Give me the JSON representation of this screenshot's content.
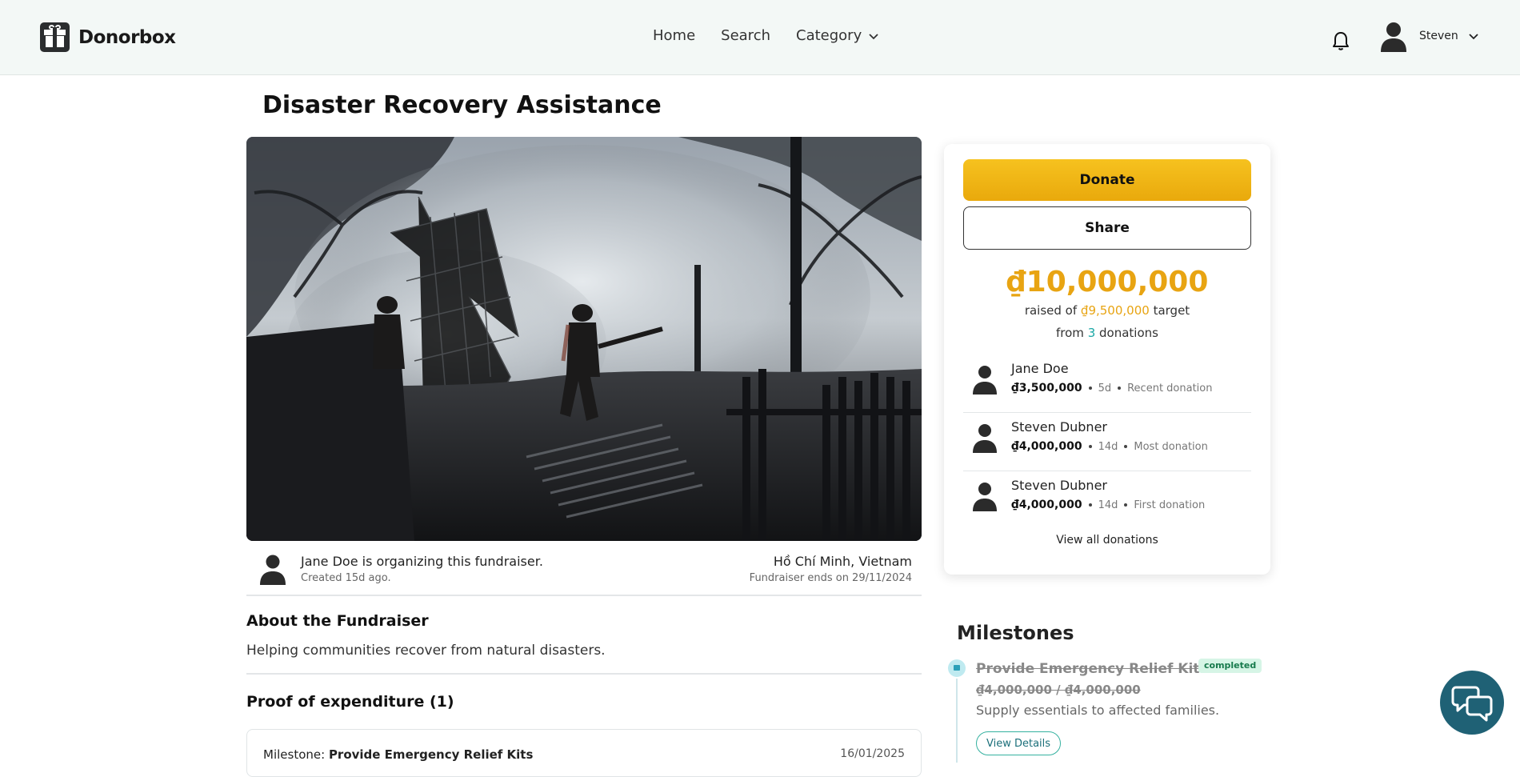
{
  "header": {
    "logo_text": "Donorbox",
    "nav": [
      {
        "label": "Home"
      },
      {
        "label": "Search"
      },
      {
        "label": "Category"
      }
    ],
    "user_name": "Steven"
  },
  "page": {
    "title": "Disaster Recovery Assistance"
  },
  "organizer": {
    "line": "Jane Doe is organizing this fundraiser.",
    "created": "Created 15d ago.",
    "location": "Hồ Chí Minh, Vietnam",
    "ends": "Fundraiser ends on 29/11/2024"
  },
  "about": {
    "title": "About the Fundraiser",
    "text": "Helping communities recover from natural disasters."
  },
  "proof": {
    "title": "Proof of expenditure (1)",
    "milestone_prefix": "Milestone: ",
    "milestone_name": "Provide Emergency Relief Kits",
    "date": "16/01/2025"
  },
  "panel": {
    "donate_label": "Donate",
    "share_label": "Share",
    "raised": "₫10,000,000",
    "raised_of_prefix": "raised of ",
    "target": "₫9,500,000",
    "target_suffix": " target",
    "from_prefix": "from ",
    "donation_count": "3",
    "from_suffix": " donations",
    "donors": [
      {
        "name": "Jane Doe",
        "amount": "₫3,500,000",
        "age": "5d",
        "tag": "Recent donation"
      },
      {
        "name": "Steven Dubner",
        "amount": "₫4,000,000",
        "age": "14d",
        "tag": "Most donation"
      },
      {
        "name": "Steven Dubner",
        "amount": "₫4,000,000",
        "age": "14d",
        "tag": "First donation"
      }
    ],
    "view_all": "View all donations"
  },
  "milestones": {
    "title": "Milestones",
    "items": [
      {
        "name": "Provide Emergency Relief Kits",
        "status": "completed",
        "amount": "₫4,000,000 / ₫4,000,000",
        "description": "Supply essentials to affected families.",
        "button": "View Details"
      }
    ]
  },
  "colors": {
    "accent_gold": "#e8a412",
    "teal": "#1aa7a5",
    "chat_button": "#1f6175"
  },
  "icons": {
    "bell": "bell-icon",
    "chat": "chat-bubbles-icon",
    "chevron": "chevron-down-icon",
    "avatar": "user-avatar-icon"
  }
}
